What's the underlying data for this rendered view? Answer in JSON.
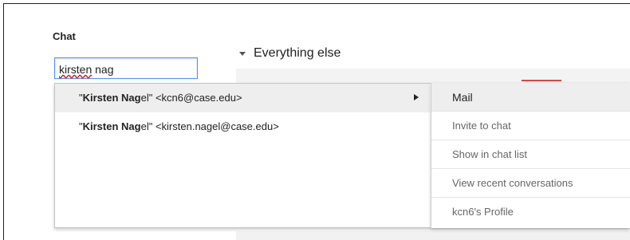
{
  "chat": {
    "label": "Chat",
    "search_value_typo": "kirsten",
    "search_value_rest": " nag"
  },
  "group": {
    "label": "Everything else"
  },
  "suggestions": [
    {
      "bold1": "Kirsten Nag",
      "rest1": "el",
      "email": "<kcn6@case.edu>",
      "quote_open": "\"",
      "quote_close": "\" "
    },
    {
      "bold1": "Kirsten Nag",
      "rest1": "el",
      "email": "<kirsten.nagel@case.edu>",
      "quote_open": "\"",
      "quote_close": "\" "
    }
  ],
  "context_menu": {
    "items": [
      {
        "label": "Mail"
      },
      {
        "label": "Invite to chat"
      },
      {
        "label": "Show in chat list"
      },
      {
        "label": "View recent conversations"
      },
      {
        "label": "kcn6's Profile"
      }
    ]
  }
}
